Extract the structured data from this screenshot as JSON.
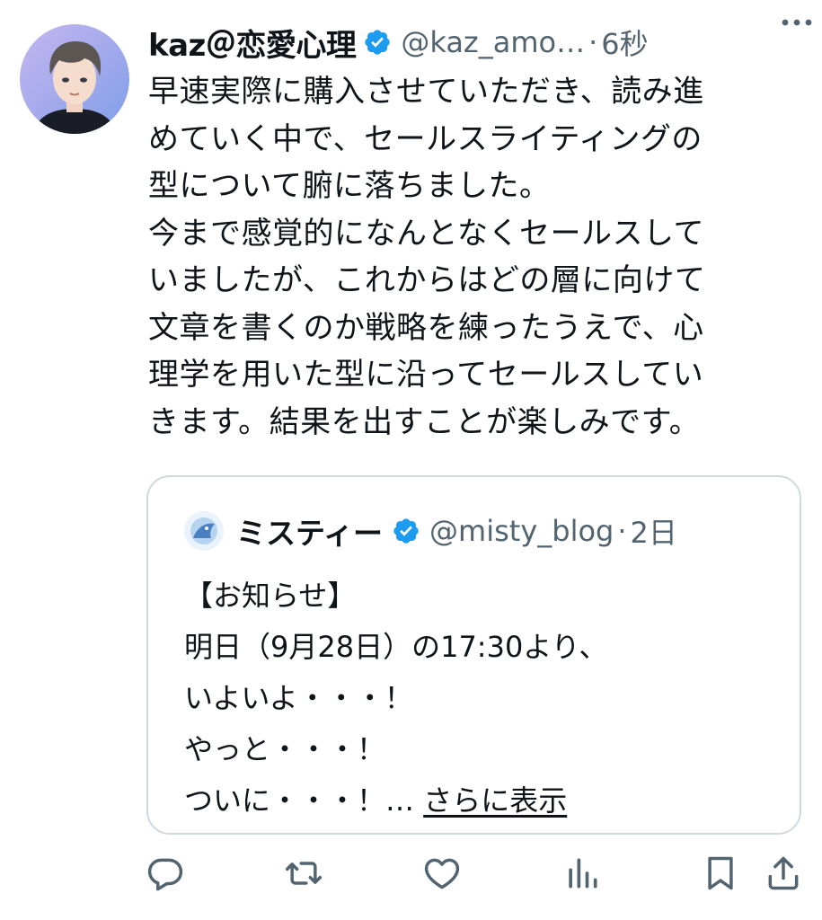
{
  "tweet": {
    "author_name": "kaz＠恋愛心理",
    "handle": "@kaz_amo…",
    "separator": "·",
    "time": "6秒",
    "text": "早速実際に購入させていただき、読み進\nめていく中で、セールスライティングの\n型について腑に落ちました。\n今まで感覚的になんとなくセールスして\nいましたが、これからはどの層に向けて\n文章を書くのか戦略を練ったうえで、心\n理学を用いた型に沿ってセールスしてい\nきます。結果を出すことが楽しみです。"
  },
  "quoted": {
    "author_name": "ミスティー",
    "handle": "@misty_blog",
    "separator": "·",
    "time": "2日",
    "text": "【お知らせ】\n明日（9月28日）の17:30より、\nいよいよ・・・！\nやっと・・・！\nついに・・・！… ",
    "show_more": "さらに表示"
  },
  "icons": {
    "verified": "verified-badge-icon",
    "more": "more-horizontal-icon",
    "reply": "reply-icon",
    "retweet": "retweet-icon",
    "like": "like-icon",
    "views": "views-icon",
    "bookmark": "bookmark-icon",
    "share": "share-icon"
  },
  "colors": {
    "text": "#0f1419",
    "secondary": "#536471",
    "verified": "#1d9bf0",
    "border": "#cfd9de"
  }
}
